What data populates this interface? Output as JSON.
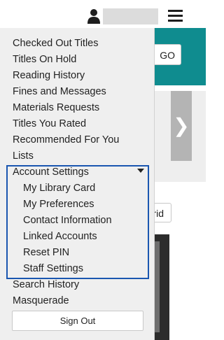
{
  "header": {
    "user_icon": "user-icon",
    "menu_icon": "hamburger-icon"
  },
  "background": {
    "go_label": "GO",
    "grid_label": "rid",
    "carousel_next_glyph": "❯"
  },
  "menu": {
    "items": [
      "Checked Out Titles",
      "Titles On Hold",
      "Reading History",
      "Fines and Messages",
      "Materials Requests",
      "Titles You Rated",
      "Recommended For You",
      "Lists"
    ],
    "account_settings": {
      "label": "Account Settings",
      "sub_items": [
        "My Library Card",
        "My Preferences",
        "Contact Information",
        "Linked Accounts",
        "Reset PIN",
        "Staff Settings"
      ]
    },
    "bottom_items": [
      "Search History",
      "Masquerade"
    ],
    "sign_out_label": "Sign Out"
  },
  "colors": {
    "teal": "#0f8c8f",
    "focus_outline": "#1a56b0",
    "menu_bg": "#efefef"
  }
}
